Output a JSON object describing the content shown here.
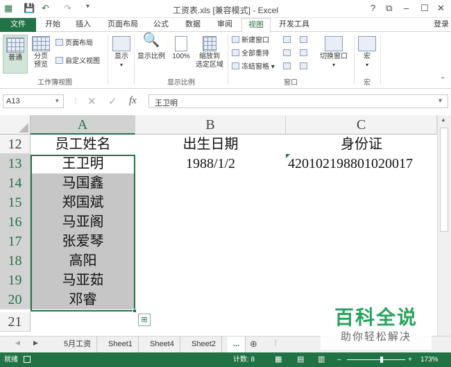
{
  "window": {
    "title": "工资表.xls  [兼容模式] - Excel",
    "help": "?",
    "login": "登录"
  },
  "ribbon_tabs": [
    "文件",
    "开始",
    "插入",
    "页面布局",
    "公式",
    "数据",
    "审阅",
    "视图",
    "开发工具"
  ],
  "ribbon": {
    "normal": "普通",
    "page_break": [
      "分页",
      "预览"
    ],
    "page_layout": "页面布局",
    "custom_view": "自定义视图",
    "show": "显示",
    "zoom": "显示比例",
    "zoom100": "100%",
    "zoom_sel": [
      "缩放到",
      "选定区域"
    ],
    "new_window": "新建窗口",
    "arrange_all": "全部重排",
    "freeze": "冻结窗格",
    "switch_window": "切换窗口",
    "macro": "宏",
    "groups": {
      "workbook_views": "工作簿视图",
      "zoom": "显示比例",
      "window": "窗口",
      "macro": "宏"
    }
  },
  "formula_bar": {
    "name_box": "A13",
    "fx": "fx",
    "value": "王卫明"
  },
  "columns": [
    "A",
    "B",
    "C"
  ],
  "rows": [
    {
      "num": "12",
      "a": "员工姓名",
      "b": "出生日期",
      "c": "身份证"
    },
    {
      "num": "13",
      "a": "王卫明",
      "b": "1988/1/2",
      "c": "420102198801020017"
    },
    {
      "num": "14",
      "a": "马国鑫",
      "b": "",
      "c": ""
    },
    {
      "num": "15",
      "a": "郑国斌",
      "b": "",
      "c": ""
    },
    {
      "num": "16",
      "a": "马亚阁",
      "b": "",
      "c": ""
    },
    {
      "num": "17",
      "a": "张爱琴",
      "b": "",
      "c": ""
    },
    {
      "num": "18",
      "a": "高阳",
      "b": "",
      "c": ""
    },
    {
      "num": "19",
      "a": "马亚茹",
      "b": "",
      "c": ""
    },
    {
      "num": "20",
      "a": "邓睿",
      "b": "",
      "c": ""
    },
    {
      "num": "21",
      "a": "",
      "b": "",
      "c": ""
    }
  ],
  "sheet_tabs": [
    "5月工资",
    "Sheet1",
    "Sheet4",
    "Sheet2",
    "..."
  ],
  "status": {
    "mode": "就绪",
    "count": "计数: 8",
    "zoom": "173%"
  },
  "watermark": {
    "title": "百科全说",
    "subtitle": "助你轻松解决"
  },
  "colors": {
    "accent": "#217346"
  }
}
